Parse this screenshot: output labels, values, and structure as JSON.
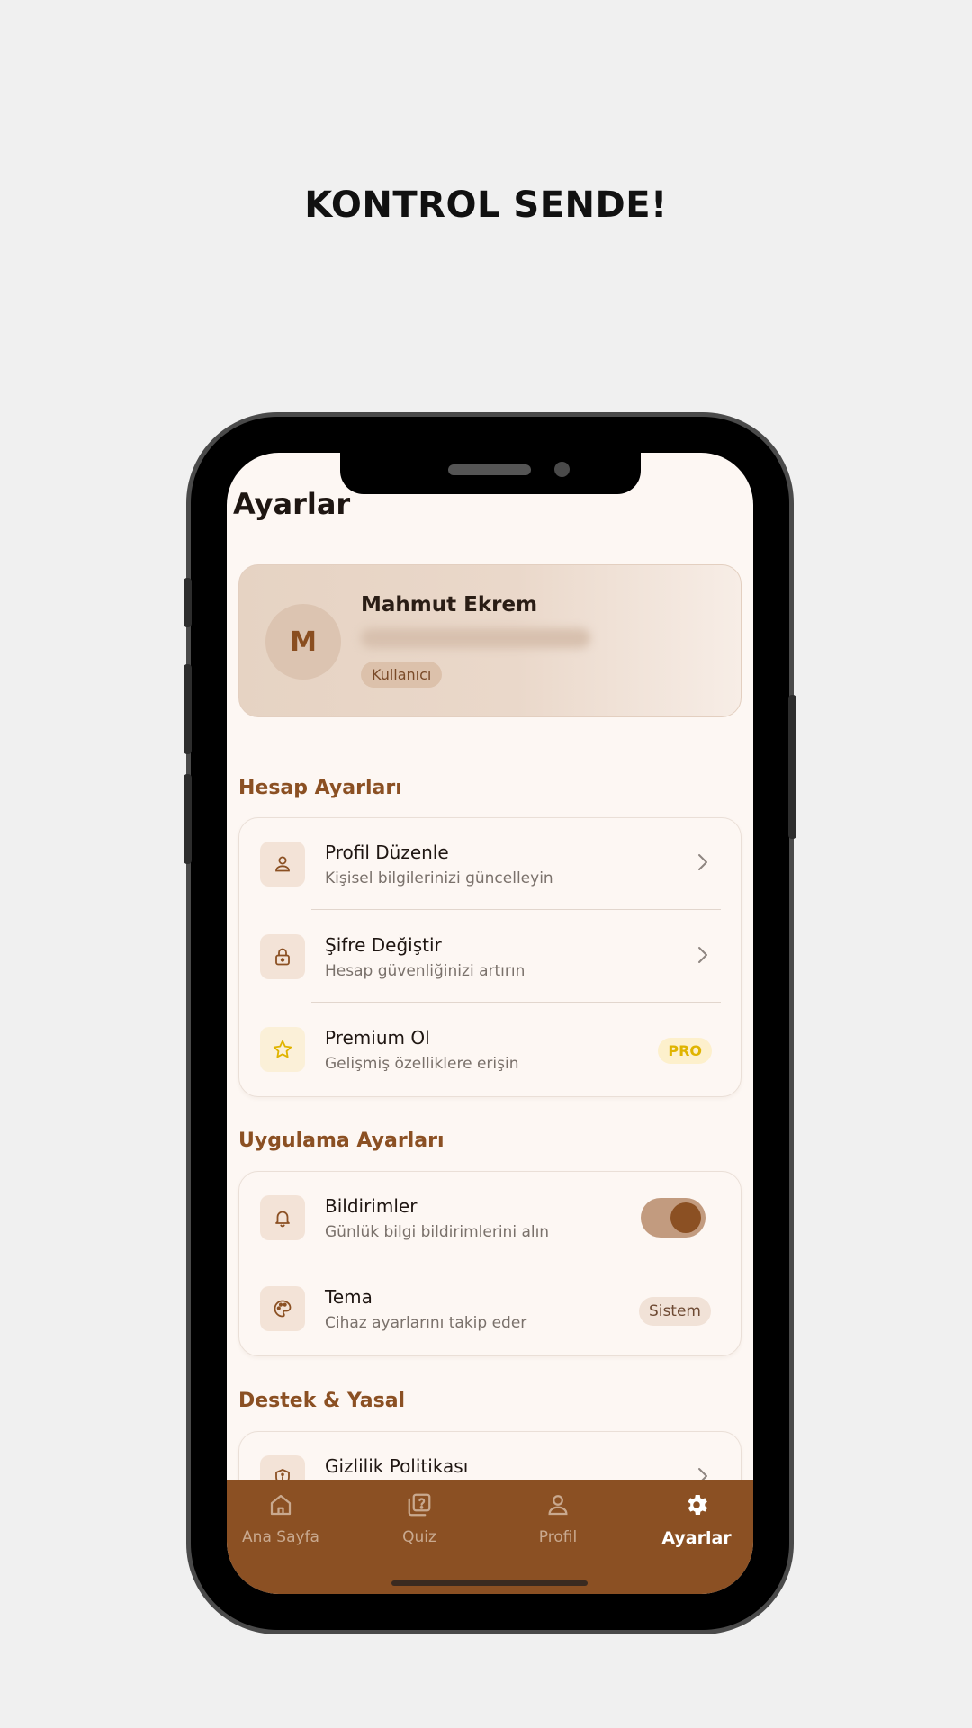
{
  "headline": "KONTROL SENDE!",
  "screen": {
    "title": "Ayarlar",
    "profile": {
      "avatar_initial": "M",
      "name": "Mahmut Ekrem",
      "role": "Kullanıcı"
    },
    "sections": {
      "account": {
        "title": "Hesap Ayarları",
        "items": [
          {
            "title": "Profil Düzenle",
            "subtitle": "Kişisel bilgilerinizi güncelleyin",
            "icon": "person-icon"
          },
          {
            "title": "Şifre Değiştir",
            "subtitle": "Hesap güvenliğinizi artırın",
            "icon": "lock-icon"
          },
          {
            "title": "Premium Ol",
            "subtitle": "Gelişmiş özelliklere erişin",
            "icon": "star-icon",
            "badge": "PRO"
          }
        ]
      },
      "app": {
        "title": "Uygulama Ayarları",
        "items": [
          {
            "title": "Bildirimler",
            "subtitle": "Günlük bilgi bildirimlerini alın",
            "icon": "bell-icon",
            "toggle_on": true
          },
          {
            "title": "Tema",
            "subtitle": "Cihaz ayarlarını takip eder",
            "icon": "palette-icon",
            "badge": "Sistem"
          }
        ]
      },
      "support": {
        "title": "Destek & Yasal",
        "items": [
          {
            "title": "Gizlilik Politikası",
            "icon": "shield-icon"
          }
        ]
      }
    },
    "bottom_nav": [
      {
        "label": "Ana Sayfa",
        "icon": "home-icon",
        "active": false
      },
      {
        "label": "Quiz",
        "icon": "quiz-icon",
        "active": false
      },
      {
        "label": "Profil",
        "icon": "person-icon",
        "active": false
      },
      {
        "label": "Ayarlar",
        "icon": "gear-icon",
        "active": true
      }
    ]
  },
  "colors": {
    "brand": "#8b5023",
    "background": "#fdf7f3",
    "pro_badge": "#e0b400"
  }
}
